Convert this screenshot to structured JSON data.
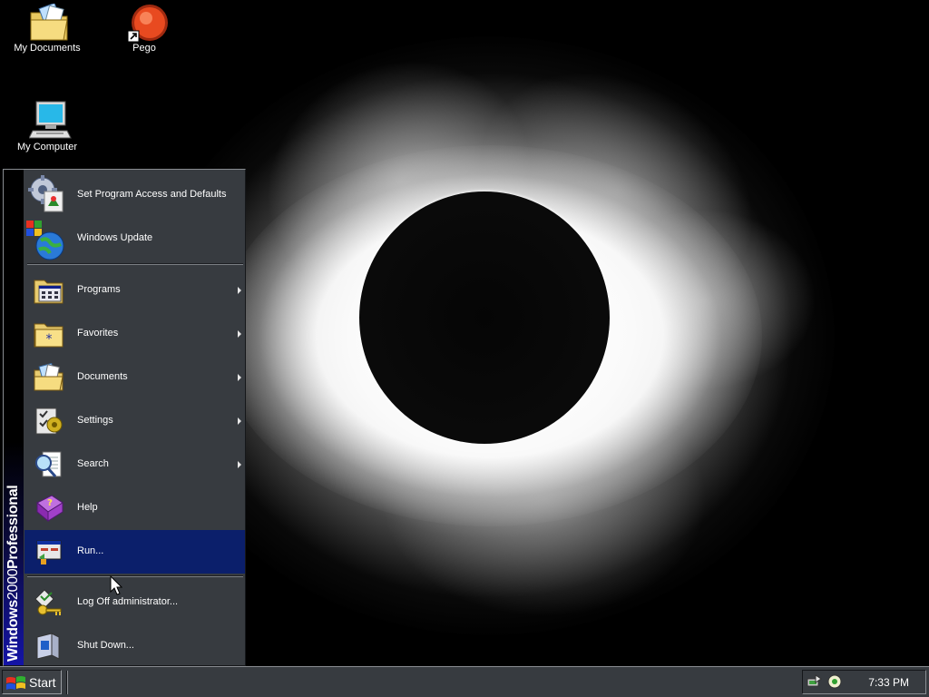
{
  "desktop": {
    "icons": [
      {
        "label": "My Documents",
        "icon": "folder-documents-icon"
      },
      {
        "label": "Pego",
        "icon": "pego-shortcut-icon"
      },
      {
        "label": "My Computer",
        "icon": "computer-icon"
      }
    ]
  },
  "start_menu": {
    "banner": {
      "bold_a": "Windows",
      "thin": "2000",
      "bold_b": "Professional"
    },
    "top_items": [
      {
        "label": "Set Program Access and Defaults",
        "icon": "program-access-icon"
      },
      {
        "label": "Windows Update",
        "icon": "windows-update-icon"
      }
    ],
    "main_items": [
      {
        "label": "Programs",
        "icon": "programs-icon",
        "submenu": true
      },
      {
        "label": "Favorites",
        "icon": "favorites-icon",
        "submenu": true
      },
      {
        "label": "Documents",
        "icon": "documents-icon",
        "submenu": true
      },
      {
        "label": "Settings",
        "icon": "settings-icon",
        "submenu": true
      },
      {
        "label": "Search",
        "icon": "search-icon",
        "submenu": true
      },
      {
        "label": "Help",
        "icon": "help-icon",
        "submenu": false
      },
      {
        "label": "Run...",
        "icon": "run-icon",
        "submenu": false,
        "selected": true
      }
    ],
    "bottom_items": [
      {
        "label": "Log Off administrator...",
        "icon": "log-off-icon"
      },
      {
        "label": "Shut Down...",
        "icon": "shut-down-icon"
      }
    ]
  },
  "taskbar": {
    "start_label": "Start",
    "tray_icons": [
      "network-icon",
      "volume-icon"
    ],
    "clock": "7:33 PM"
  },
  "colors": {
    "menu_bg": "#373b40",
    "selected_bg": "#0b1f6b",
    "banner_blue": "#1414a6"
  }
}
